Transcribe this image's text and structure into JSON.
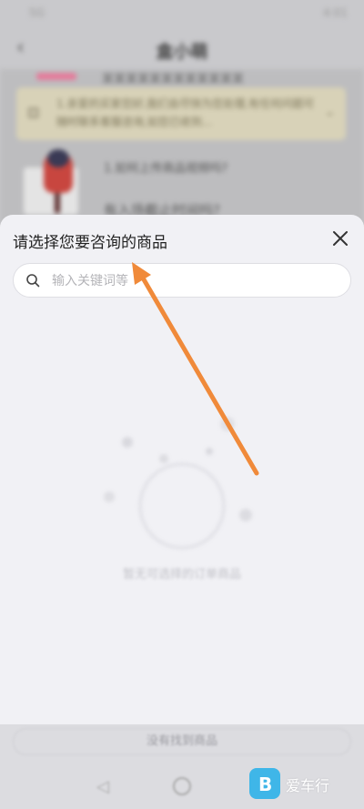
{
  "status_bar": {
    "time": "5G",
    "signal": "4:01"
  },
  "header": {
    "title": "盒小萌",
    "back_icon": "chevron-left-icon"
  },
  "chat": {
    "prev_line": "某某某某某某某某某某某某",
    "notice_text": "1.亲爱的买家您好,我们会尽快为您处理,有任何问题可随时联系客服咨询,如您已收到...",
    "question_1": "1.如何上传商品视频吗?",
    "question_2": "有入场截止时间吗?"
  },
  "sheet": {
    "title": "请选择您要咨询的商品",
    "close_icon": "close-icon",
    "search": {
      "placeholder": "输入关键词等",
      "value": "",
      "icon": "search-icon"
    },
    "empty_text": "暂无可选择的订单商品"
  },
  "bottom": {
    "button_label": "没有找到商品"
  },
  "watermark": {
    "text": "爱车行"
  },
  "colors": {
    "sheet_bg": "#f1f1f5",
    "arrow": "#f08a3a",
    "accent": "#3fb6e8"
  }
}
